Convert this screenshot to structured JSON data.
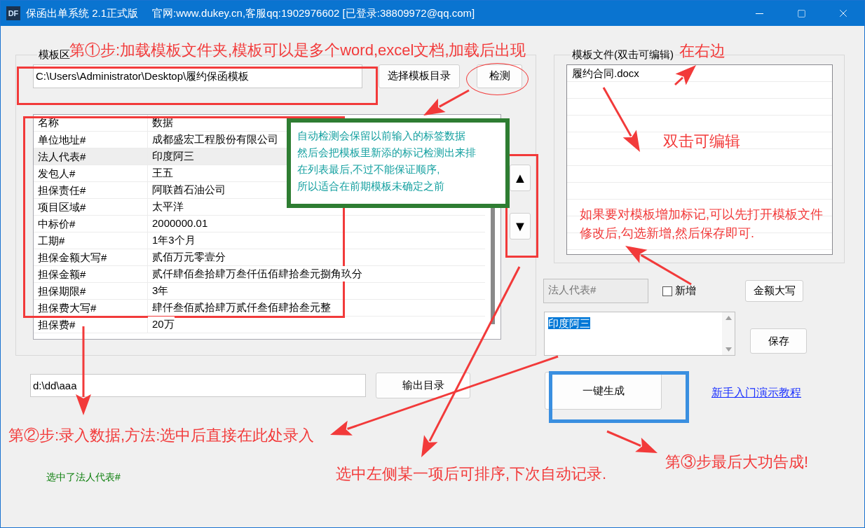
{
  "window": {
    "icon_text": "DF",
    "title": "保函出单系统 2.1正式版",
    "subtitle": "官网:www.dukey.cn,客服qq:1902976602 [已登录:38809972@qq.com]"
  },
  "template_area": {
    "title": "模板区",
    "path": "C:\\Users\\Administrator\\Desktop\\履约保函模板",
    "buttons": [
      "选择模板目录",
      "检测"
    ],
    "table": {
      "columns": [
        "名称",
        "数据"
      ],
      "rows": [
        {
          "name": "单位地址#",
          "value": "成都盛宏工程股份有限公司",
          "selected": false
        },
        {
          "name": "法人代表#",
          "value": "印度阿三",
          "selected": true
        },
        {
          "name": "发包人#",
          "value": "王五",
          "selected": false
        },
        {
          "name": "担保责任#",
          "value": "阿联酋石油公司",
          "selected": false
        },
        {
          "name": "项目区域#",
          "value": "太平洋",
          "selected": false
        },
        {
          "name": "中标价#",
          "value": "2000000.01",
          "selected": false
        },
        {
          "name": "工期#",
          "value": "1年3个月",
          "selected": false
        },
        {
          "name": "担保金额大写#",
          "value": "贰佰万元零壹分",
          "selected": false
        },
        {
          "name": "担保金额#",
          "value": "贰仟肆佰叁拾肆万叁仟伍佰肆拾叁元捌角玖分",
          "selected": false
        },
        {
          "name": "担保期限#",
          "value": "3年",
          "selected": false
        },
        {
          "name": "担保费大写#",
          "value": "肆仟叁佰贰拾肆万贰仟叁佰肆拾叁元整",
          "selected": false
        },
        {
          "name": "担保费#",
          "value": "20万",
          "selected": false
        }
      ]
    },
    "move_buttons": [
      "▲",
      "▼"
    ]
  },
  "template_files": {
    "title": "模板文件(双击可编辑)",
    "files": [
      {
        "name": "履约合同.docx",
        "selected": false
      }
    ]
  },
  "editor": {
    "tag_field": {
      "value": "法人代表#",
      "disabled": true
    },
    "new_checkbox": {
      "label": "新增",
      "checked": false
    },
    "uppercase_button": "金额大写",
    "value_text": {
      "value": "印度阿三",
      "highlighted": true
    },
    "save_button": "保存"
  },
  "output": {
    "path": "d:\\dd\\aaa",
    "button": "输出目录"
  },
  "generate_button": "一键生成",
  "tutorial_link": "新手入门演示教程",
  "status": "选中了法人代表#",
  "annotations": {
    "step1": "第①步:加载模板文件夹,模板可以是多个word,excel文档,加载后出现",
    "right_side": "在右边",
    "double_click": "双击可编辑",
    "add_tag_tip": [
      "如果要对模板增加标记,可以先打开模板文件",
      "修改后,勾选新增,然后保存即可."
    ],
    "detect_tip": [
      "自动检测会保留以前输入的标签数据",
      "然后会把模板里新添的标记检测出来排",
      "在列表最后,不过不能保证顺序,",
      "所以适合在前期模板未确定之前"
    ],
    "step2": "第②步:录入数据,方法:选中后直接在此处录入",
    "sort_tip": "选中左侧某一项后可排序,下次自动记录.",
    "step3": "第③步最后大功告成!"
  }
}
